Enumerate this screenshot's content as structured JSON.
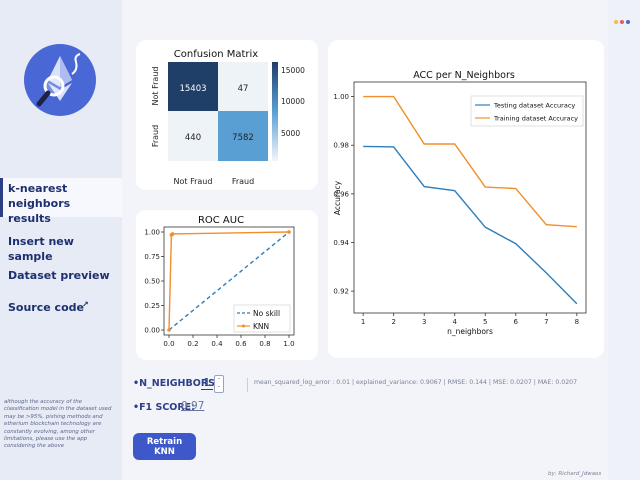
{
  "sidebar": {
    "nav": [
      {
        "label_line1": "k-nearest neighbors",
        "label_line2": "results"
      },
      {
        "label": "Insert new sample"
      },
      {
        "label": "Dataset preview"
      },
      {
        "label": "Source code"
      }
    ],
    "note": "although the accuracy of the classification model in the dataset used may be >95%, pishing methods and etherium blockchain technology are constantly evolving, among other limitations, please use the app considering the above"
  },
  "confusion_matrix": {
    "title": "Confusion Matrix",
    "cells": [
      [
        "15403",
        "47"
      ],
      [
        "440",
        "7582"
      ]
    ],
    "x_labels": [
      "Not Fraud",
      "Fraud"
    ],
    "y_labels": [
      "Not Fraud",
      "Fraud"
    ],
    "colorbar_ticks": [
      "15000",
      "10000",
      "5000"
    ],
    "colors": {
      "dark": "#1f3e68",
      "light": "#eef3f8",
      "mid": "#5a9fd4"
    }
  },
  "roc": {
    "title": "ROC AUC",
    "x_ticks": [
      "0.0",
      "0.2",
      "0.4",
      "0.6",
      "0.8",
      "1.0"
    ],
    "y_ticks": [
      "0.00",
      "0.25",
      "0.50",
      "0.75",
      "1.00"
    ],
    "legend": [
      "No skill",
      "KNN"
    ]
  },
  "acc_chart": {
    "title": "ACC per N_Neighbors",
    "xlabel": "n_neighbors",
    "ylabel": "Accuracy",
    "y_ticks": [
      "1.00",
      "0.98",
      "0.96",
      "0.94",
      "0.92"
    ],
    "x_ticks": [
      "1",
      "2",
      "3",
      "4",
      "5",
      "6",
      "7",
      "8"
    ]
  },
  "chart_data": [
    {
      "type": "line",
      "title": "ACC per N_Neighbors",
      "xlabel": "n_neighbors",
      "ylabel": "Accuracy",
      "x": [
        1,
        2,
        3,
        4,
        5,
        6,
        7,
        8
      ],
      "series": [
        {
          "name": "Testing dataset Accuracy",
          "color": "#2e7ebc",
          "values": [
            0.9795,
            0.9793,
            0.963,
            0.9613,
            0.9463,
            0.9395,
            0.9275,
            0.9148
          ]
        },
        {
          "name": "Training dataset Accuracy",
          "color": "#f28e2b",
          "values": [
            1.0,
            1.0,
            0.9805,
            0.9805,
            0.9628,
            0.9622,
            0.9473,
            0.9465
          ]
        }
      ],
      "xlim": [
        0.7,
        8.3
      ],
      "ylim": [
        0.911,
        1.006
      ],
      "legend": "top-right"
    },
    {
      "type": "line",
      "title": "ROC AUC",
      "series": [
        {
          "name": "No skill",
          "color": "#2e7ebc",
          "style": "dashed",
          "x": [
            0,
            1
          ],
          "y": [
            0,
            1
          ]
        },
        {
          "name": "KNN",
          "color": "#f28e2b",
          "x": [
            0,
            0.02,
            0.03,
            1
          ],
          "y": [
            0,
            0.97,
            0.98,
            1
          ]
        }
      ],
      "xlim": [
        0,
        1
      ],
      "ylim": [
        0,
        1
      ],
      "legend": "bottom-right"
    },
    {
      "type": "heatmap",
      "title": "Confusion Matrix",
      "x_categories": [
        "Not Fraud",
        "Fraud"
      ],
      "y_categories": [
        "Not Fraud",
        "Fraud"
      ],
      "values": [
        [
          15403,
          47
        ],
        [
          440,
          7582
        ]
      ]
    }
  ],
  "controls": {
    "n_neighbors_label": "•N_NEIGHBORS:",
    "n_neighbors_value": "1",
    "f1_label": "•F1 SCORE:",
    "f1_value": "0.97",
    "stats": "mean_squared_log_error : 0.01  |  explained_variance: 0.9067  |  RMSE: 0.144  |  MSE: 0.0207  |  MAE: 0.0207",
    "retrain_label": "Retrain KNN"
  },
  "footer": {
    "credit": "by: Richard_Jdwaos"
  },
  "dots": [
    "#f6b94a",
    "#ea5b5b",
    "#4a67d6"
  ]
}
